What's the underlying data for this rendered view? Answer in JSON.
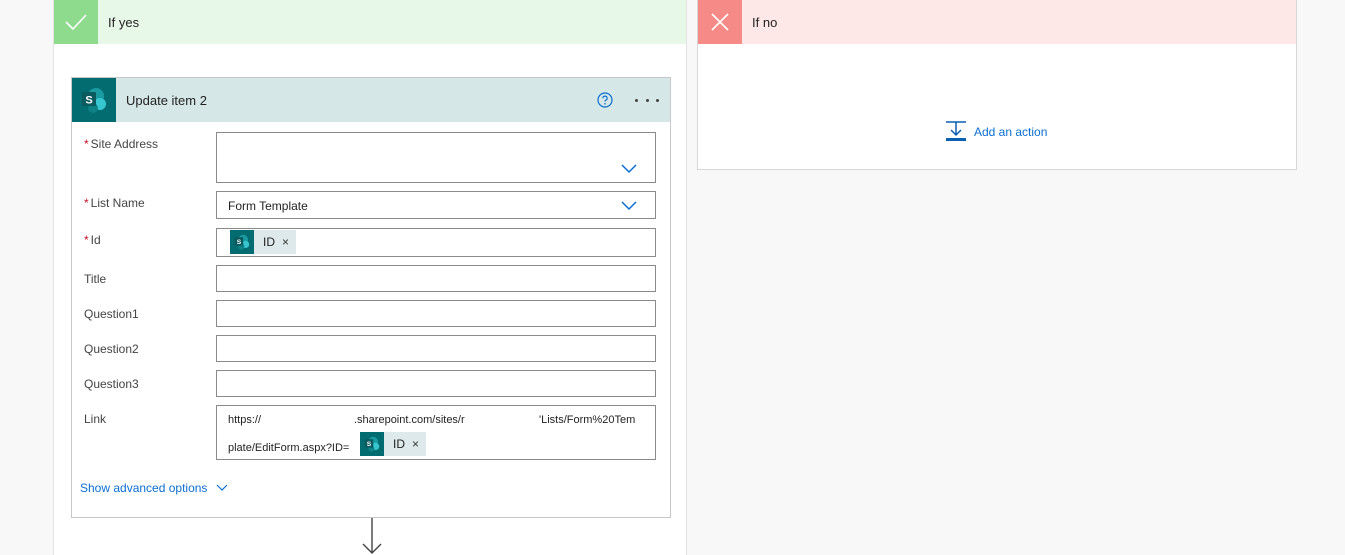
{
  "yes_branch": {
    "title": "If yes",
    "card": {
      "title": "Update item 2",
      "fields": {
        "site_address": {
          "label": "Site Address",
          "required_mark": "*",
          "value": ""
        },
        "list_name": {
          "label": "List Name",
          "required_mark": "*",
          "value": "Form Template"
        },
        "id": {
          "label": "Id",
          "required_mark": "*",
          "token": {
            "label": "ID",
            "remove": "×"
          }
        },
        "title": {
          "label": "Title",
          "value": ""
        },
        "question1": {
          "label": "Question1",
          "value": ""
        },
        "question2": {
          "label": "Question2",
          "value": ""
        },
        "question3": {
          "label": "Question3",
          "value": ""
        },
        "link": {
          "label": "Link",
          "line1_part1": "https://",
          "line1_part2": ".sharepoint.com/sites/r",
          "line1_part3": "'Lists/Form%20Tem",
          "line2": "plate/EditForm.aspx?ID=",
          "token": {
            "label": "ID",
            "remove": "×"
          }
        }
      },
      "show_advanced": "Show advanced options"
    }
  },
  "no_branch": {
    "title": "If no",
    "add_action": "Add an action"
  },
  "colors": {
    "yes_header": "#e8f8e8",
    "yes_icon": "#8edb8e",
    "no_header": "#fde7e7",
    "no_icon": "#f68a87",
    "sharepoint": "#036c70",
    "card_header": "#d6e7e7",
    "link": "#0b6fd1",
    "required": "#c8102e"
  },
  "icons": [
    "check-icon",
    "close-icon",
    "sharepoint-icon",
    "help-icon",
    "more-options-icon",
    "chevron-down-icon",
    "add-action-icon",
    "arrow-down-icon"
  ]
}
